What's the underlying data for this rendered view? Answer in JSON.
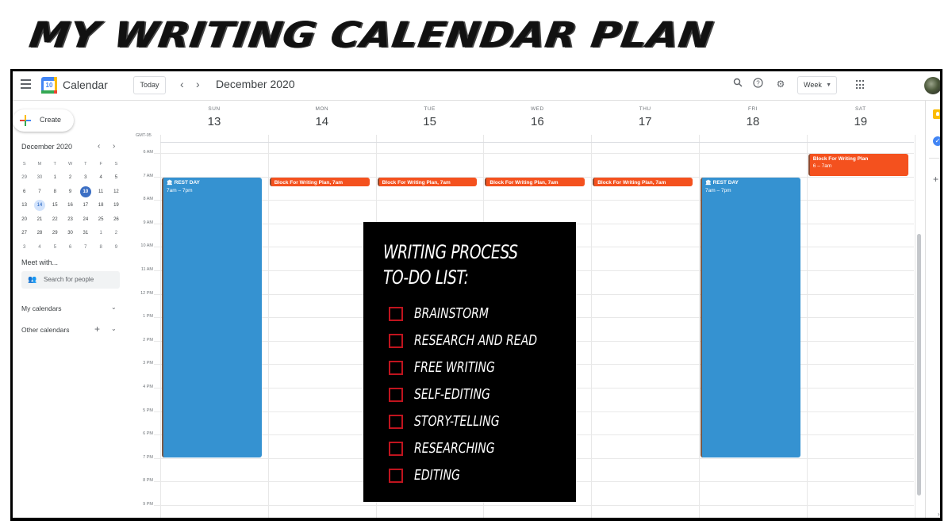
{
  "page_title": "MY WRITING CALENDAR PLAN",
  "header": {
    "menu_icon": "hamburger-menu-icon",
    "logo_day": "10",
    "app_name": "Calendar",
    "today_label": "Today",
    "prev_icon": "‹",
    "next_icon": "›",
    "month_title": "December 2020",
    "search_icon": "search-icon",
    "help_icon": "?",
    "settings_icon": "⚙",
    "view_select": "Week",
    "apps_icon": "apps-grid-icon",
    "avatar": "user-avatar"
  },
  "sidebar": {
    "create_label": "Create",
    "mini_calendar": {
      "title": "December 2020",
      "prev": "‹",
      "next": "›",
      "weekday_headers": [
        "S",
        "M",
        "T",
        "W",
        "T",
        "F",
        "S"
      ],
      "weeks": [
        [
          "29",
          "30",
          "1",
          "2",
          "3",
          "4",
          "5"
        ],
        [
          "6",
          "7",
          "8",
          "9",
          "10",
          "11",
          "12"
        ],
        [
          "13",
          "14",
          "15",
          "16",
          "17",
          "18",
          "19"
        ],
        [
          "20",
          "21",
          "22",
          "23",
          "24",
          "25",
          "26"
        ],
        [
          "27",
          "28",
          "29",
          "30",
          "31",
          "1",
          "2"
        ],
        [
          "3",
          "4",
          "5",
          "6",
          "7",
          "8",
          "9"
        ]
      ],
      "today": "10",
      "selected": "14"
    },
    "meet_with_label": "Meet with...",
    "search_people_placeholder": "Search for people",
    "my_calendars_label": "My calendars",
    "other_calendars_label": "Other calendars",
    "add_icon": "+",
    "chevron_icon": "⌄"
  },
  "week_view": {
    "timezone": "GMT-05",
    "days": [
      {
        "dow": "SUN",
        "num": "13"
      },
      {
        "dow": "MON",
        "num": "14"
      },
      {
        "dow": "TUE",
        "num": "15"
      },
      {
        "dow": "WED",
        "num": "16"
      },
      {
        "dow": "THU",
        "num": "17"
      },
      {
        "dow": "FRI",
        "num": "18"
      },
      {
        "dow": "SAT",
        "num": "19"
      }
    ],
    "hours": [
      "6 AM",
      "7 AM",
      "8 AM",
      "9 AM",
      "10 AM",
      "11 AM",
      "12 PM",
      "1 PM",
      "2 PM",
      "3 PM",
      "4 PM",
      "5 PM",
      "6 PM",
      "7 PM",
      "8 PM",
      "9 PM"
    ],
    "events": [
      {
        "day": "SUN",
        "title": "REST DAY",
        "time": "7am – 7pm",
        "icon": "🏛",
        "color": "#3592d1"
      },
      {
        "day": "MON",
        "title": "Block For Writing Plan, 7am",
        "color": "#f4511e"
      },
      {
        "day": "TUE",
        "title": "Block For Writing Plan, 7am",
        "color": "#f4511e"
      },
      {
        "day": "WED",
        "title": "Block For Writing Plan, 7am",
        "color": "#f4511e"
      },
      {
        "day": "THU",
        "title": "Block For Writing Plan, 7am",
        "color": "#f4511e"
      },
      {
        "day": "FRI",
        "title": "REST DAY",
        "time": "7am – 7pm",
        "icon": "🏛",
        "color": "#3592d1"
      },
      {
        "day": "SAT",
        "title": "Block For Writing Plan",
        "time": "6 – 7am",
        "color": "#f4511e"
      }
    ]
  },
  "todo_list": {
    "title_line1": "WRITING PROCESS",
    "title_line2": "TO-DO LIST:",
    "items": [
      {
        "label": "BRAINSTORM",
        "checked": false
      },
      {
        "label": "RESEARCH AND READ",
        "checked": false
      },
      {
        "label": "FREE WRITING",
        "checked": false
      },
      {
        "label": "SELF-EDITING",
        "checked": false
      },
      {
        "label": "STORY-TELLING",
        "checked": false
      },
      {
        "label": "RESEARCHING",
        "checked": false
      },
      {
        "label": "EDITING",
        "checked": false
      }
    ]
  },
  "side_panel": {
    "keep_icon": "keep-icon",
    "tasks_icon": "✓",
    "add_icon": "+",
    "expand_icon": "›"
  }
}
